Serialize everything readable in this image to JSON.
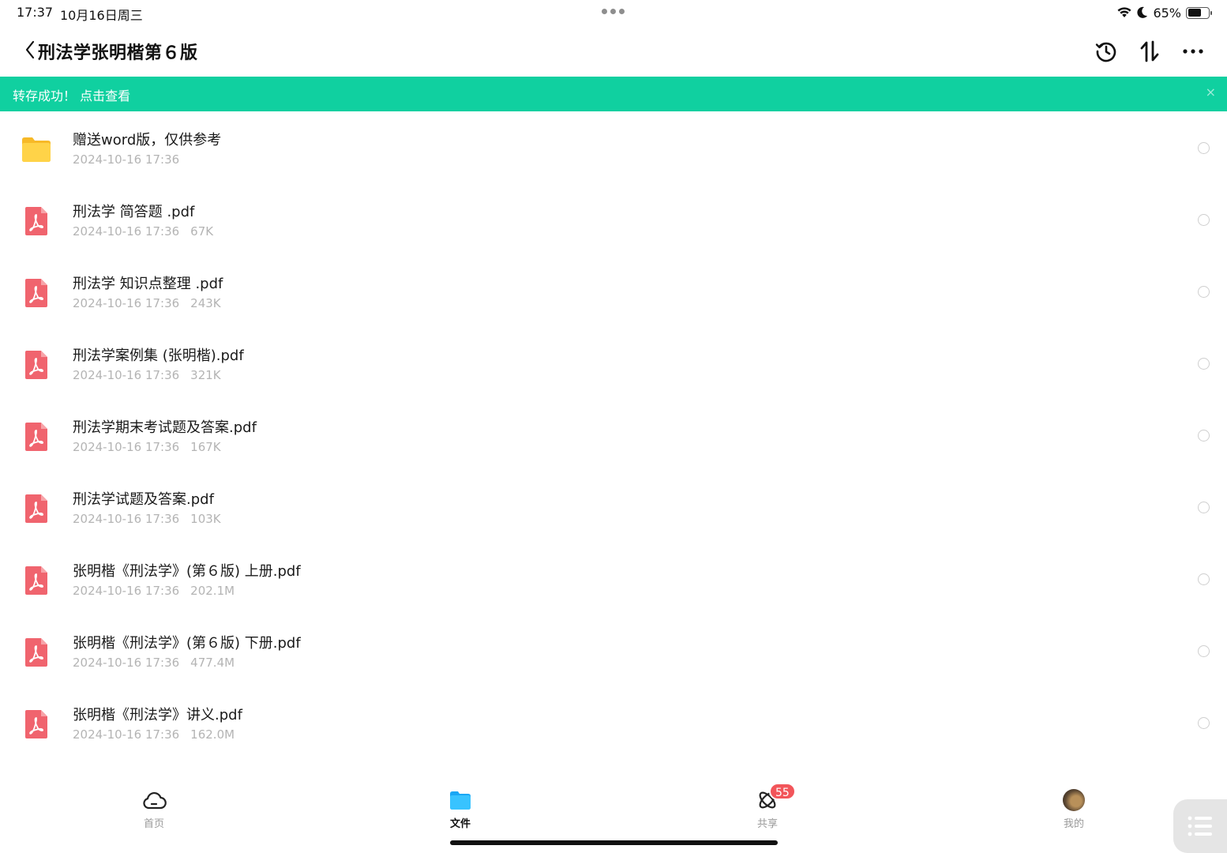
{
  "status_bar": {
    "time": "17:37",
    "date": "10月16日周三",
    "battery_percent": "65%",
    "battery_level": 0.65,
    "icons": [
      "wifi-icon",
      "moon-icon",
      "battery-icon"
    ]
  },
  "nav": {
    "title": "刑法学张明楷第６版",
    "actions": [
      "history-icon",
      "sort-icon",
      "more-icon"
    ]
  },
  "banner": {
    "text": "转存成功！ 点击查看",
    "close": "×",
    "color": "#10d0a0"
  },
  "files": [
    {
      "type": "folder",
      "name": "赠送word版，仅供参考",
      "date": "2024-10-16 17:36",
      "size": ""
    },
    {
      "type": "pdf",
      "name": "刑法学 简答题 .pdf",
      "date": "2024-10-16 17:36",
      "size": "67K"
    },
    {
      "type": "pdf",
      "name": "刑法学 知识点整理 .pdf",
      "date": "2024-10-16 17:36",
      "size": "243K"
    },
    {
      "type": "pdf",
      "name": "刑法学案例集 (张明楷).pdf",
      "date": "2024-10-16 17:36",
      "size": "321K"
    },
    {
      "type": "pdf",
      "name": "刑法学期末考试题及答案.pdf",
      "date": "2024-10-16 17:36",
      "size": "167K"
    },
    {
      "type": "pdf",
      "name": "刑法学试题及答案.pdf",
      "date": "2024-10-16 17:36",
      "size": "103K"
    },
    {
      "type": "pdf",
      "name": "张明楷《刑法学》(第６版) 上册.pdf",
      "date": "2024-10-16 17:36",
      "size": "202.1M"
    },
    {
      "type": "pdf",
      "name": "张明楷《刑法学》(第６版) 下册.pdf",
      "date": "2024-10-16 17:36",
      "size": "477.4M"
    },
    {
      "type": "pdf",
      "name": "张明楷《刑法学》讲义.pdf",
      "date": "2024-10-16 17:36",
      "size": "162.0M"
    }
  ],
  "tabs": [
    {
      "label": "首页",
      "icon": "cloud-icon",
      "active": false
    },
    {
      "label": "文件",
      "icon": "folder-icon",
      "active": true
    },
    {
      "label": "共享",
      "icon": "share-icon",
      "active": false,
      "badge": "55"
    },
    {
      "label": "我的",
      "icon": "avatar",
      "active": false
    }
  ],
  "colors": {
    "accent": "#10d0a0",
    "pdf": "#f0646e",
    "folder": "#ffcf3f",
    "badge": "#f2555a",
    "active_tab": "#1aa7f5"
  }
}
